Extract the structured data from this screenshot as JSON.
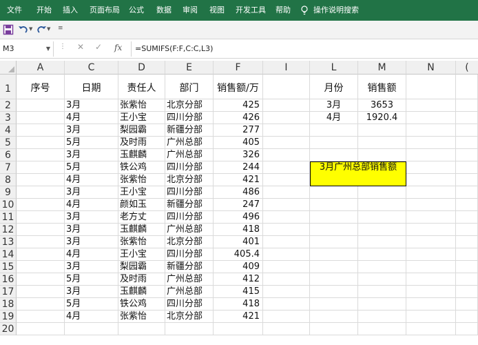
{
  "ribbon": {
    "tabs": [
      "文件",
      "开始",
      "插入",
      "页面布局",
      "公式",
      "数据",
      "审阅",
      "视图",
      "开发工具",
      "帮助"
    ],
    "tell_me": "操作说明搜索",
    "color": "#217346"
  },
  "qat": {
    "icons": [
      "save-icon",
      "undo-icon",
      "redo-icon",
      "customize-icon"
    ]
  },
  "formula_bar": {
    "name_box": "M3",
    "formula": "=SUMIFS(F:F,C:C,L3)"
  },
  "columns": [
    "A",
    "C",
    "D",
    "E",
    "F",
    "I",
    "L",
    "M",
    "N"
  ],
  "rows": [
    "1",
    "2",
    "3",
    "4",
    "5",
    "6",
    "7",
    "8",
    "9",
    "10",
    "11",
    "12",
    "13",
    "14",
    "15",
    "16",
    "17",
    "18",
    "19",
    "20"
  ],
  "table": {
    "headers": [
      "序号",
      "日期",
      "责任人",
      "部门",
      "销售额/万"
    ],
    "rows": [
      [
        "",
        "3月",
        "张紫怡",
        "北京分部",
        "425"
      ],
      [
        "",
        "4月",
        "王小宝",
        "四川分部",
        "426"
      ],
      [
        "",
        "3月",
        "梨园霸",
        "新疆分部",
        "277"
      ],
      [
        "",
        "5月",
        "及时雨",
        "广州总部",
        "405"
      ],
      [
        "",
        "3月",
        "玉麒麟",
        "广州总部",
        "326"
      ],
      [
        "",
        "5月",
        "铁公鸡",
        "四川分部",
        "244"
      ],
      [
        "",
        "4月",
        "张紫怡",
        "北京分部",
        "421"
      ],
      [
        "",
        "3月",
        "王小宝",
        "四川分部",
        "486"
      ],
      [
        "",
        "4月",
        "颜如玉",
        "新疆分部",
        "247"
      ],
      [
        "",
        "3月",
        "老方丈",
        "四川分部",
        "496"
      ],
      [
        "",
        "3月",
        "玉麒麟",
        "广州总部",
        "418"
      ],
      [
        "",
        "3月",
        "张紫怡",
        "北京分部",
        "401"
      ],
      [
        "",
        "4月",
        "王小宝",
        "四川分部",
        "405.4"
      ],
      [
        "",
        "3月",
        "梨园霸",
        "新疆分部",
        "409"
      ],
      [
        "",
        "5月",
        "及时雨",
        "广州总部",
        "412"
      ],
      [
        "",
        "3月",
        "玉麒麟",
        "广州总部",
        "415"
      ],
      [
        "",
        "5月",
        "铁公鸡",
        "四川分部",
        "418"
      ],
      [
        "",
        "4月",
        "张紫怡",
        "北京分部",
        "421"
      ]
    ]
  },
  "summary": {
    "headers": [
      "月份",
      "销售额"
    ],
    "rows": [
      [
        "3月",
        "3653"
      ],
      [
        "4月",
        "1920.4"
      ]
    ]
  },
  "highlight_label": "3月广州总部销售额",
  "highlight_color": "#ffff00"
}
